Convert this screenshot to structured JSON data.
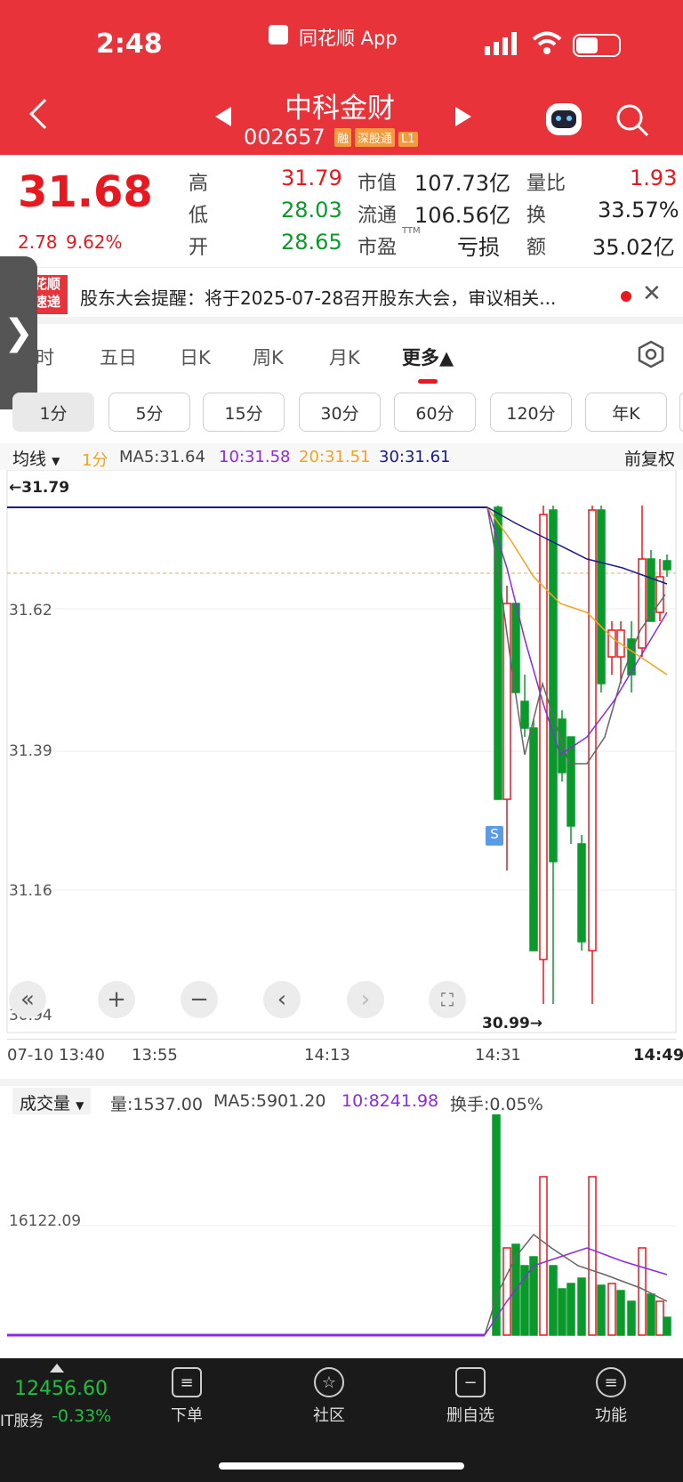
{
  "status": {
    "time": "2:48",
    "app": "同花顺 App"
  },
  "header": {
    "name": "中科金财",
    "code": "002657",
    "tags": [
      "融",
      "深股通",
      "L1"
    ]
  },
  "quote": {
    "price": "31.68",
    "change": "2.78",
    "pct": "9.62%",
    "high_label": "高",
    "high": "31.79",
    "low_label": "低",
    "low": "28.03",
    "open_label": "开",
    "open": "28.65",
    "mcap_label": "市值",
    "mcap": "107.73亿",
    "float_label": "流通",
    "float": "106.56亿",
    "pe_label": "市盈",
    "pe_sup": "TTM",
    "pe": "亏损",
    "vr_label": "量比",
    "vr": "1.93",
    "turn_label": "换",
    "turn": "33.57%",
    "amt_label": "额",
    "amt": "35.02亿"
  },
  "notice": {
    "logo_top": "花顺",
    "logo_bottom": "速递",
    "text": "股东大会提醒：将于2025-07-28召开股东大会，审议相关..."
  },
  "period_tabs": [
    "时",
    "五日",
    "日K",
    "周K",
    "月K",
    "更多▲"
  ],
  "interval_tabs": [
    "1分",
    "5分",
    "15分",
    "30分",
    "60分",
    "120分",
    "年K"
  ],
  "ma_bar": {
    "mode": "均线",
    "interval": "1分",
    "ma5": "MA5:31.64",
    "ma10": "10:31.58",
    "ma20": "20:31.51",
    "ma30": "30:31.61",
    "adjust": "前复权"
  },
  "price_chart": {
    "y_labels": [
      "31.62",
      "31.39",
      "31.16",
      "30.94"
    ],
    "top_label": "←31.79",
    "low_marker": "30.99→",
    "signal": "S",
    "x_labels": [
      "07-10 13:40",
      "13:55",
      "14:13",
      "14:31",
      "14:49"
    ]
  },
  "volume_bar": {
    "mode": "成交量",
    "vol": "量:1537.00",
    "ma5": "MA5:5901.20",
    "ma10": "10:8241.98",
    "turnover": "换手:0.05%",
    "y_label": "16122.09"
  },
  "bottom": {
    "index_value": "12456.60",
    "index_name": "IT服务",
    "index_change": "-0.33%",
    "nav": [
      "下单",
      "社区",
      "删自选",
      "功能"
    ]
  },
  "colors": {
    "up": "#e8181f",
    "down": "#0a9a2c",
    "header": "#e8333a"
  }
}
